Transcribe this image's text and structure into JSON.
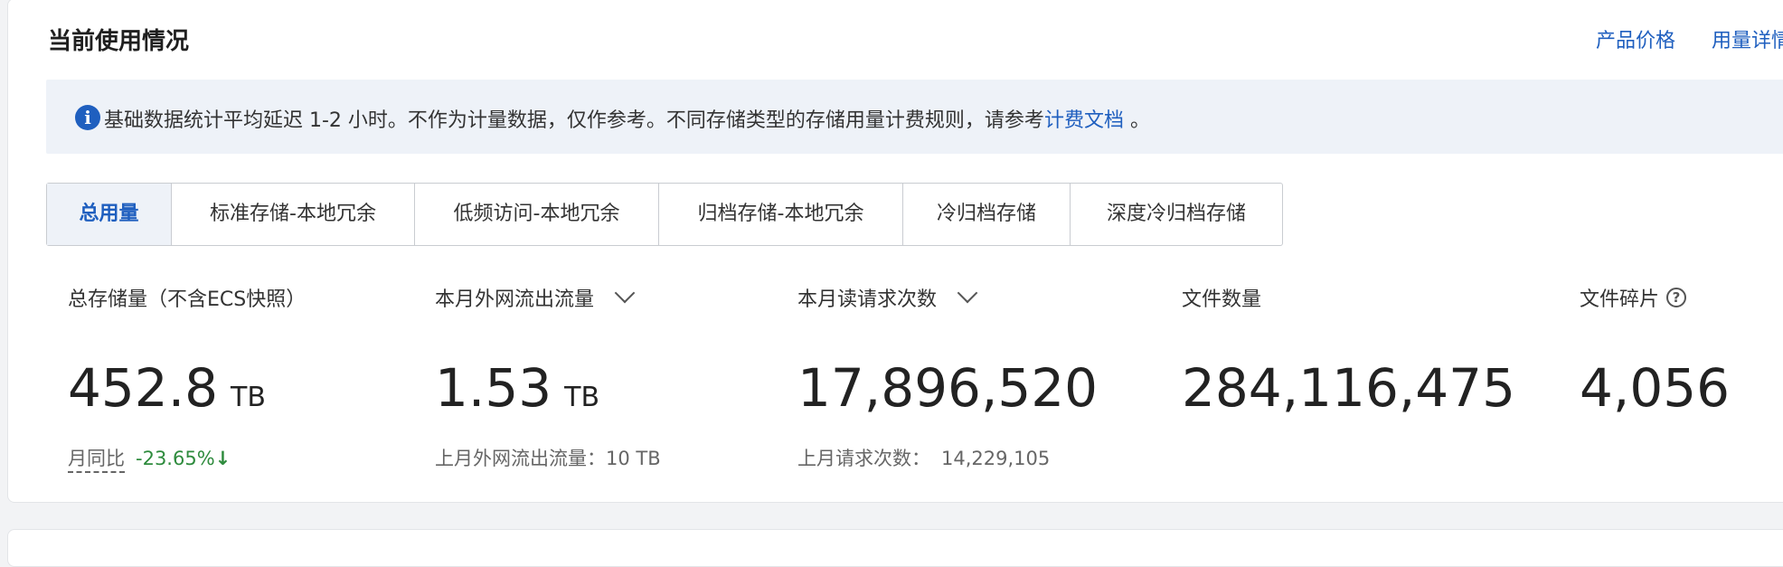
{
  "header": {
    "title": "当前使用情况",
    "links": [
      "产品价格",
      "用量详情"
    ]
  },
  "notice": {
    "text": "基础数据统计平均延迟 1-2 小时。不作为计量数据，仅作参考。不同存储类型的存储用量计费规则，请参考",
    "link": "计费文档",
    "suffix": " 。",
    "icon": "info-icon"
  },
  "tabs": [
    "总用量",
    "标准存储-本地冗余",
    "低频访问-本地冗余",
    "归档存储-本地冗余",
    "冷归档存储",
    "深度冷归档存储"
  ],
  "metrics": {
    "storage": {
      "label": "总存储量（不含ECS快照）",
      "value": "452.8",
      "unit": "TB",
      "compare_label": "月同比",
      "compare_value": "-23.65%",
      "compare_arrow": "↓"
    },
    "traffic": {
      "label": "本月外网流出流量",
      "value": "1.53",
      "unit": "TB",
      "sub": "上月外网流出流量：10 TB"
    },
    "requests": {
      "label": "本月读请求次数",
      "value": "17,896,520",
      "sub_label": "上月请求次数：",
      "sub_value": "14,229,105"
    },
    "files": {
      "label": "文件数量",
      "value": "284,116,475"
    },
    "fragments": {
      "label": "文件碎片",
      "value": "4,056",
      "help": "?"
    }
  },
  "colors": {
    "accent": "#1f5fbf",
    "positive": "#2e8b3d",
    "notice_bg": "#eef2f8"
  }
}
